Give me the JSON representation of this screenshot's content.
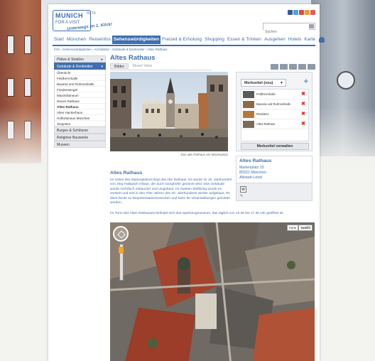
{
  "site": {
    "logo_line1": "MUNICH",
    "logo_line2": "FOR A VISIT",
    "logo_badge": "BETA",
    "logo_slogan": "Unterwegs im 1. Klick!",
    "search_placeholder": "Suchen"
  },
  "colors": {
    "brand_blue": "#3f6fb0",
    "delete_red": "#d8322b"
  },
  "social_icons": [
    "facebook-icon",
    "twitter-icon",
    "google-plus-icon",
    "rss-icon",
    "extra-icon"
  ],
  "nav": {
    "items": [
      "Start",
      "München",
      "Reiseinfos",
      "Sehenswürdigkeiten",
      "Freizeit & Erholung",
      "Shopping",
      "Essen & Trinken",
      "Ausgehen",
      "Hotels",
      "Karte"
    ],
    "active_index": 3
  },
  "breadcrumb": "FAV › Sehenswürdigkeiten › Architektur › Gebäude & Denkmäler › Altes Rathaus",
  "sidebar": {
    "sections": [
      {
        "label": "Plätze & Straßen",
        "arrow": "▸"
      },
      {
        "label": "Gebäude & Denkmäler",
        "arrow": "▾"
      }
    ],
    "items": [
      "Übersicht",
      "Feldherrnhalle",
      "Bavaria und Ruhmeshalle",
      "Friedensengel",
      "Maximilianeum",
      "Neues Rathaus",
      "Altes Rathaus",
      "Altes Hackerhaus",
      "Hofbräuhaus München",
      "Siegestor"
    ],
    "current_item": "Altes Rathaus",
    "bottom_sections": [
      "Burgen & Schlösser",
      "Religiöse Bauwerke",
      "Museen"
    ]
  },
  "page": {
    "title": "Altes Rathaus",
    "tabs": [
      "Bilder",
      "Street View"
    ],
    "toolbar_icons": [
      "share-icon",
      "favorite-icon",
      "audio-icon",
      "mail-icon",
      "print-icon"
    ],
    "photo_caption": "Das alte Rathaus am Marienplatz",
    "section_title": "Altes Rathaus",
    "description": "Im Osten des Marienplatzes liegt das Alte Rathaus. Es wurde im 15. Jahrhundert von Jörg Halspach erbaut, der auch Ganghofer genannt wird. Das Gebäude wurde mehrfach restauriert und umgebaut. Im zweiten Weltkrieg wurde es zerstört und erst in den 70er Jahren des 20. Jahrhunderts wieder aufgebaut. Es dient heute zu Repräsentationszwecken und kann für Veranstaltungen gemietet werden.",
    "description2": "Im Turm des Alten Rathauses befindet sich das Spielzeugmuseum, das täglich von 10.00 bis 17.30 Uhr geöffnet ist."
  },
  "merkzettel": {
    "select_value": "Merkzettel (neu)",
    "add_label": "+",
    "items": [
      "Feldherrnhalle",
      "Bavaria und Ruhmeshalle",
      "Residenz",
      "Altes Rathaus"
    ],
    "delete_label": "✖",
    "manage_button": "Merkzettel verwalten"
  },
  "address": {
    "name": "Altes Rathaus",
    "street": "Marienplatz 15",
    "city": "80331 München",
    "district": "Altstadt-Lehel"
  },
  "map": {
    "type_buttons": [
      "Karte",
      "Satellit"
    ],
    "active_type": "Satellit"
  }
}
